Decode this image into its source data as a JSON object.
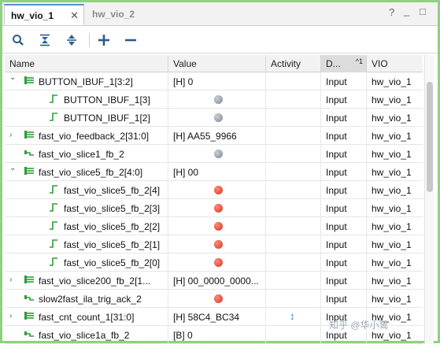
{
  "tabs": [
    {
      "label": "hw_vio_1",
      "active": true
    },
    {
      "label": "hw_vio_2",
      "active": false
    }
  ],
  "window_controls": {
    "help": "?",
    "minimize": "_",
    "maximize": "□"
  },
  "toolbar": {
    "icons": [
      "search-icon",
      "collapse-all-icon",
      "expand-all-icon",
      "add-icon",
      "remove-icon"
    ]
  },
  "columns": {
    "name": "Name",
    "value": "Value",
    "activity": "Activity",
    "direction": "D...",
    "direction_sort": "^1",
    "vio": "VIO"
  },
  "rows": [
    {
      "name": "BUTTON_IBUF_1[3:2]",
      "level": 0,
      "expander": "expanded",
      "icon": "bus-icon",
      "value": "[H] 0",
      "led": "",
      "activity": "",
      "dir": "Input",
      "vio": "hw_vio_1"
    },
    {
      "name": "BUTTON_IBUF_1[3]",
      "level": 1,
      "expander": "none",
      "icon": "bit-icon",
      "value": "",
      "led": "gray",
      "activity": "",
      "dir": "Input",
      "vio": "hw_vio_1"
    },
    {
      "name": "BUTTON_IBUF_1[2]",
      "level": 1,
      "expander": "none",
      "icon": "bit-icon",
      "value": "",
      "led": "gray",
      "activity": "",
      "dir": "Input",
      "vio": "hw_vio_1"
    },
    {
      "name": "fast_vio_feedback_2[31:0]",
      "level": 0,
      "expander": "collapsed",
      "icon": "bus-icon",
      "value": "[H] AA55_9966",
      "led": "",
      "activity": "",
      "dir": "Input",
      "vio": "hw_vio_1"
    },
    {
      "name": "fast_vio_slice1_fb_2",
      "level": 0,
      "expander": "none",
      "icon": "wire-icon",
      "value": "",
      "led": "gray",
      "activity": "",
      "dir": "Input",
      "vio": "hw_vio_1"
    },
    {
      "name": "fast_vio_slice5_fb_2[4:0]",
      "level": 0,
      "expander": "expanded",
      "icon": "bus-icon",
      "value": "[H] 00",
      "led": "",
      "activity": "",
      "dir": "Input",
      "vio": "hw_vio_1"
    },
    {
      "name": "fast_vio_slice5_fb_2[4]",
      "level": 1,
      "expander": "none",
      "icon": "bit-icon",
      "value": "",
      "led": "red",
      "activity": "",
      "dir": "Input",
      "vio": "hw_vio_1"
    },
    {
      "name": "fast_vio_slice5_fb_2[3]",
      "level": 1,
      "expander": "none",
      "icon": "bit-icon",
      "value": "",
      "led": "red",
      "activity": "",
      "dir": "Input",
      "vio": "hw_vio_1"
    },
    {
      "name": "fast_vio_slice5_fb_2[2]",
      "level": 1,
      "expander": "none",
      "icon": "bit-icon",
      "value": "",
      "led": "red",
      "activity": "",
      "dir": "Input",
      "vio": "hw_vio_1"
    },
    {
      "name": "fast_vio_slice5_fb_2[1]",
      "level": 1,
      "expander": "none",
      "icon": "bit-icon",
      "value": "",
      "led": "red",
      "activity": "",
      "dir": "Input",
      "vio": "hw_vio_1"
    },
    {
      "name": "fast_vio_slice5_fb_2[0]",
      "level": 1,
      "expander": "none",
      "icon": "bit-icon",
      "value": "",
      "led": "red",
      "activity": "",
      "dir": "Input",
      "vio": "hw_vio_1"
    },
    {
      "name": "fast_vio_slice200_fb_2[1...",
      "level": 0,
      "expander": "collapsed",
      "icon": "bus-icon",
      "value": "[H] 00_0000_0000...",
      "led": "",
      "activity": "",
      "dir": "Input",
      "vio": "hw_vio_1"
    },
    {
      "name": "slow2fast_ila_trig_ack_2",
      "level": 0,
      "expander": "none",
      "icon": "wire-icon",
      "value": "",
      "led": "red",
      "activity": "",
      "dir": "Input",
      "vio": "hw_vio_1"
    },
    {
      "name": "fast_cnt_count_1[31:0]",
      "level": 0,
      "expander": "collapsed",
      "icon": "bus-icon",
      "value": "[H] 58C4_BC34",
      "led": "",
      "activity": "↕",
      "dir": "Input",
      "vio": "hw_vio_1"
    },
    {
      "name": "fast_vio_slice1a_fb_2",
      "level": 0,
      "expander": "none",
      "icon": "wire-icon",
      "value": "[B] 0",
      "led": "",
      "activity": "",
      "dir": "Input",
      "vio": "hw_vio_1"
    }
  ],
  "watermark": "知乎 @华小鹭"
}
